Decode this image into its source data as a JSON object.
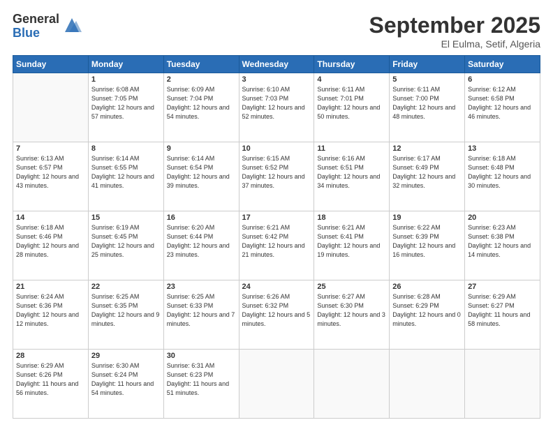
{
  "logo": {
    "general": "General",
    "blue": "Blue"
  },
  "header": {
    "month": "September 2025",
    "location": "El Eulma, Setif, Algeria"
  },
  "days_of_week": [
    "Sunday",
    "Monday",
    "Tuesday",
    "Wednesday",
    "Thursday",
    "Friday",
    "Saturday"
  ],
  "weeks": [
    [
      {
        "day": "",
        "sunrise": "",
        "sunset": "",
        "daylight": ""
      },
      {
        "day": "1",
        "sunrise": "Sunrise: 6:08 AM",
        "sunset": "Sunset: 7:05 PM",
        "daylight": "Daylight: 12 hours and 57 minutes."
      },
      {
        "day": "2",
        "sunrise": "Sunrise: 6:09 AM",
        "sunset": "Sunset: 7:04 PM",
        "daylight": "Daylight: 12 hours and 54 minutes."
      },
      {
        "day": "3",
        "sunrise": "Sunrise: 6:10 AM",
        "sunset": "Sunset: 7:03 PM",
        "daylight": "Daylight: 12 hours and 52 minutes."
      },
      {
        "day": "4",
        "sunrise": "Sunrise: 6:11 AM",
        "sunset": "Sunset: 7:01 PM",
        "daylight": "Daylight: 12 hours and 50 minutes."
      },
      {
        "day": "5",
        "sunrise": "Sunrise: 6:11 AM",
        "sunset": "Sunset: 7:00 PM",
        "daylight": "Daylight: 12 hours and 48 minutes."
      },
      {
        "day": "6",
        "sunrise": "Sunrise: 6:12 AM",
        "sunset": "Sunset: 6:58 PM",
        "daylight": "Daylight: 12 hours and 46 minutes."
      }
    ],
    [
      {
        "day": "7",
        "sunrise": "Sunrise: 6:13 AM",
        "sunset": "Sunset: 6:57 PM",
        "daylight": "Daylight: 12 hours and 43 minutes."
      },
      {
        "day": "8",
        "sunrise": "Sunrise: 6:14 AM",
        "sunset": "Sunset: 6:55 PM",
        "daylight": "Daylight: 12 hours and 41 minutes."
      },
      {
        "day": "9",
        "sunrise": "Sunrise: 6:14 AM",
        "sunset": "Sunset: 6:54 PM",
        "daylight": "Daylight: 12 hours and 39 minutes."
      },
      {
        "day": "10",
        "sunrise": "Sunrise: 6:15 AM",
        "sunset": "Sunset: 6:52 PM",
        "daylight": "Daylight: 12 hours and 37 minutes."
      },
      {
        "day": "11",
        "sunrise": "Sunrise: 6:16 AM",
        "sunset": "Sunset: 6:51 PM",
        "daylight": "Daylight: 12 hours and 34 minutes."
      },
      {
        "day": "12",
        "sunrise": "Sunrise: 6:17 AM",
        "sunset": "Sunset: 6:49 PM",
        "daylight": "Daylight: 12 hours and 32 minutes."
      },
      {
        "day": "13",
        "sunrise": "Sunrise: 6:18 AM",
        "sunset": "Sunset: 6:48 PM",
        "daylight": "Daylight: 12 hours and 30 minutes."
      }
    ],
    [
      {
        "day": "14",
        "sunrise": "Sunrise: 6:18 AM",
        "sunset": "Sunset: 6:46 PM",
        "daylight": "Daylight: 12 hours and 28 minutes."
      },
      {
        "day": "15",
        "sunrise": "Sunrise: 6:19 AM",
        "sunset": "Sunset: 6:45 PM",
        "daylight": "Daylight: 12 hours and 25 minutes."
      },
      {
        "day": "16",
        "sunrise": "Sunrise: 6:20 AM",
        "sunset": "Sunset: 6:44 PM",
        "daylight": "Daylight: 12 hours and 23 minutes."
      },
      {
        "day": "17",
        "sunrise": "Sunrise: 6:21 AM",
        "sunset": "Sunset: 6:42 PM",
        "daylight": "Daylight: 12 hours and 21 minutes."
      },
      {
        "day": "18",
        "sunrise": "Sunrise: 6:21 AM",
        "sunset": "Sunset: 6:41 PM",
        "daylight": "Daylight: 12 hours and 19 minutes."
      },
      {
        "day": "19",
        "sunrise": "Sunrise: 6:22 AM",
        "sunset": "Sunset: 6:39 PM",
        "daylight": "Daylight: 12 hours and 16 minutes."
      },
      {
        "day": "20",
        "sunrise": "Sunrise: 6:23 AM",
        "sunset": "Sunset: 6:38 PM",
        "daylight": "Daylight: 12 hours and 14 minutes."
      }
    ],
    [
      {
        "day": "21",
        "sunrise": "Sunrise: 6:24 AM",
        "sunset": "Sunset: 6:36 PM",
        "daylight": "Daylight: 12 hours and 12 minutes."
      },
      {
        "day": "22",
        "sunrise": "Sunrise: 6:25 AM",
        "sunset": "Sunset: 6:35 PM",
        "daylight": "Daylight: 12 hours and 9 minutes."
      },
      {
        "day": "23",
        "sunrise": "Sunrise: 6:25 AM",
        "sunset": "Sunset: 6:33 PM",
        "daylight": "Daylight: 12 hours and 7 minutes."
      },
      {
        "day": "24",
        "sunrise": "Sunrise: 6:26 AM",
        "sunset": "Sunset: 6:32 PM",
        "daylight": "Daylight: 12 hours and 5 minutes."
      },
      {
        "day": "25",
        "sunrise": "Sunrise: 6:27 AM",
        "sunset": "Sunset: 6:30 PM",
        "daylight": "Daylight: 12 hours and 3 minutes."
      },
      {
        "day": "26",
        "sunrise": "Sunrise: 6:28 AM",
        "sunset": "Sunset: 6:29 PM",
        "daylight": "Daylight: 12 hours and 0 minutes."
      },
      {
        "day": "27",
        "sunrise": "Sunrise: 6:29 AM",
        "sunset": "Sunset: 6:27 PM",
        "daylight": "Daylight: 11 hours and 58 minutes."
      }
    ],
    [
      {
        "day": "28",
        "sunrise": "Sunrise: 6:29 AM",
        "sunset": "Sunset: 6:26 PM",
        "daylight": "Daylight: 11 hours and 56 minutes."
      },
      {
        "day": "29",
        "sunrise": "Sunrise: 6:30 AM",
        "sunset": "Sunset: 6:24 PM",
        "daylight": "Daylight: 11 hours and 54 minutes."
      },
      {
        "day": "30",
        "sunrise": "Sunrise: 6:31 AM",
        "sunset": "Sunset: 6:23 PM",
        "daylight": "Daylight: 11 hours and 51 minutes."
      },
      {
        "day": "",
        "sunrise": "",
        "sunset": "",
        "daylight": ""
      },
      {
        "day": "",
        "sunrise": "",
        "sunset": "",
        "daylight": ""
      },
      {
        "day": "",
        "sunrise": "",
        "sunset": "",
        "daylight": ""
      },
      {
        "day": "",
        "sunrise": "",
        "sunset": "",
        "daylight": ""
      }
    ]
  ]
}
